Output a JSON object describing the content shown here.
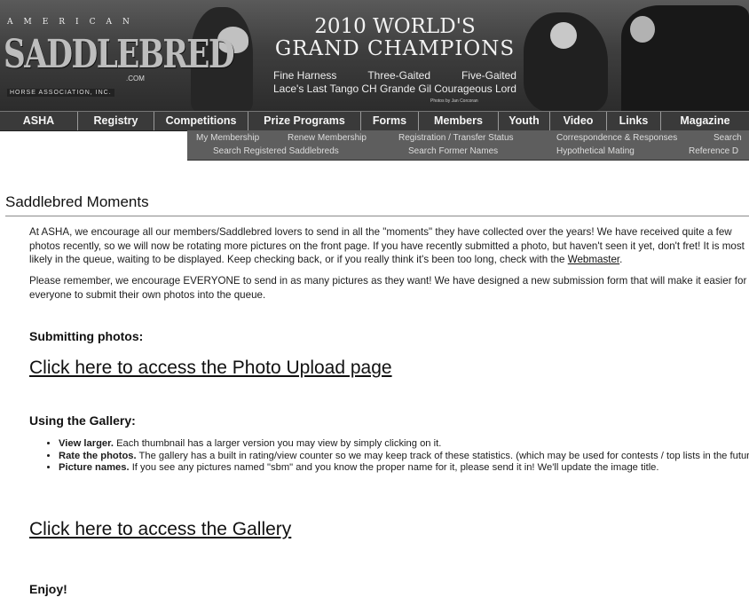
{
  "banner": {
    "logo_top": "AMERICAN",
    "logo_main": "SADDLEBRED",
    "logo_sub": "HORSE ASSOCIATION, INC.",
    "logo_com": ".COM",
    "headline_line1": "2010 WORLD'S",
    "headline_line2": "GRAND CHAMPIONS",
    "winners": [
      {
        "a": "Fine Harness",
        "b": "Three-Gaited",
        "c": "Five-Gaited"
      },
      {
        "a": "Lace's Last Tango",
        "b": "CH Grande Gil",
        "c": "Courageous Lord"
      }
    ],
    "credit": "Photos by Jan Corcoran"
  },
  "mainnav": [
    "ASHA",
    "Registry",
    "Competitions",
    "Prize Programs",
    "Forms",
    "Members",
    "Youth",
    "Video",
    "Links",
    "Magazine"
  ],
  "subnav": {
    "row1": [
      "My Membership",
      "Renew Membership",
      "Registration / Transfer Status",
      "Correspondence & Responses",
      "Search"
    ],
    "row2": [
      "Search Registered Saddlebreds",
      "Search Former Names",
      "Hypothetical Mating",
      "Reference D"
    ]
  },
  "content": {
    "title": "Saddlebred Moments",
    "p1_text": "At ASHA, we encourage all our members/Saddlebred lovers to send in all the \"moments\" they have collected over the years!  We have received quite a few photos recently, so we will now be rotating more pictures on the front page.  If you have recently submitted a photo, but haven't seen it yet, don't fret!  It is most likely in the queue, waiting to be displayed.  Keep checking back, or if you really think it's been too long, check with the ",
    "p1_link": "Webmaster",
    "p1_end": ".",
    "p2": "Please remember, we encourage EVERYONE to send in as many pictures as they want!  We have designed a new submission form that will make it easier for everyone to submit their own photos into the queue.",
    "submitting_heading": "Submitting photos:",
    "upload_link": "Click here to access the Photo Upload page",
    "gallery_heading": "Using the Gallery:",
    "bullets": [
      {
        "bold": "View larger.",
        "text": "  Each thumbnail has a larger version you may view by simply clicking on it."
      },
      {
        "bold": "Rate the photos.",
        "text": "  The gallery has a built in rating/view counter so we may keep track of these statistics.  (which may be used for contests / top lists in the future.)"
      },
      {
        "bold": "Picture names.",
        "text": "  If you see any pictures named \"sbm\" and you know the proper name for it, please send it in!  We'll update the image title."
      }
    ],
    "gallery_link": "Click here to access the Gallery",
    "enjoy": "Enjoy!"
  }
}
